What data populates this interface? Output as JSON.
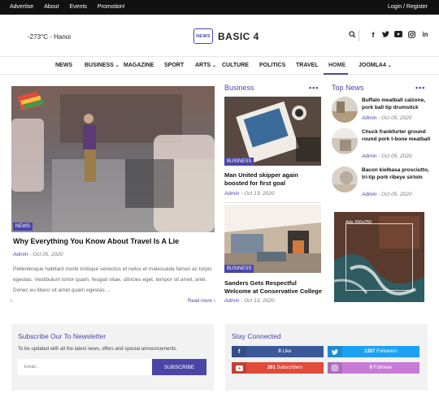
{
  "topbar": {
    "links": [
      "Advertise",
      "About",
      "Events",
      "Promotion!"
    ],
    "login": "Login / Register"
  },
  "header": {
    "weather": "-273°C - Hanoi",
    "logo_badge": "NEWS",
    "logo_text": "BASIC 4",
    "icons": [
      "search-icon",
      "facebook-icon",
      "twitter-icon",
      "youtube-icon",
      "instagram-icon",
      "linkedin-icon"
    ]
  },
  "nav": {
    "items": [
      "NEWS",
      "BUSINESS",
      "MAGAZINE",
      "SPORT",
      "ARTS",
      "CULTURE",
      "POLITICS",
      "TRAVEL",
      "HOME",
      "JOOMLA4"
    ],
    "active": "HOME"
  },
  "feature": {
    "tag": "NEWS",
    "title": "Why Everything You Know About Travel Is A Lie",
    "author": "Admin",
    "date": "- Oct 05, 2020",
    "excerpt": "Pellentesque habitant morbi tristique senectus et netus et malesuada fames ac turpis egestas. Vestibulum tortor quam, feugiat vitae, ultricies eget, tempor sit amet, ante. Donec eu libero sit amet quam egestas ...",
    "read_more": "Read more ›",
    "prev": "‹"
  },
  "business": {
    "heading": "Business",
    "dots": "•••",
    "articles": [
      {
        "tag": "BUSINESS",
        "title": "Man United skipper again boosted for first goal",
        "author": "Admin",
        "date": "- Oct 13, 2020"
      },
      {
        "tag": "BUSINESS",
        "title": "Sanders Gets Respectful Welcome at Conservative College",
        "author": "Admin",
        "date": "- Oct 13, 2020"
      }
    ]
  },
  "top_news": {
    "heading": "Top News",
    "dots": "•••",
    "items": [
      {
        "title": "Buffalo meatball calzone, pork ball tip drumstick",
        "author": "Admin",
        "date": "- Oct 05, 2020"
      },
      {
        "title": "Chuck frankfurter ground round pork t-bone meatball",
        "author": "Admin",
        "date": "- Oct 05, 2020"
      },
      {
        "title": "Bacon kielbasa prosciutto, tri-tip pork ribeye sirloin",
        "author": "Admin",
        "date": "- Oct 05, 2020"
      }
    ],
    "ad_label": "Ads 250x250"
  },
  "newsletter": {
    "heading": "Subscribe Our To Newsletter",
    "text": "To be updated with all the latest news, offers and special announcements.",
    "placeholder": "Email...",
    "button": "SUBSCRIBE"
  },
  "stay_connected": {
    "heading": "Stay Connected",
    "items": [
      {
        "network": "facebook",
        "count": "0",
        "label": "Like",
        "color": "#3b5998"
      },
      {
        "network": "twitter",
        "count": "1357",
        "label": "Followers",
        "color": "#1da1f2"
      },
      {
        "network": "youtube",
        "count": "261",
        "label": "Subscribers",
        "color": "#e04b3a"
      },
      {
        "network": "instagram",
        "count": "0",
        "label": "Followar",
        "color": "#c77ad6"
      }
    ]
  },
  "colors": {
    "accent": "#4b45a8",
    "topbar": "#111111"
  }
}
